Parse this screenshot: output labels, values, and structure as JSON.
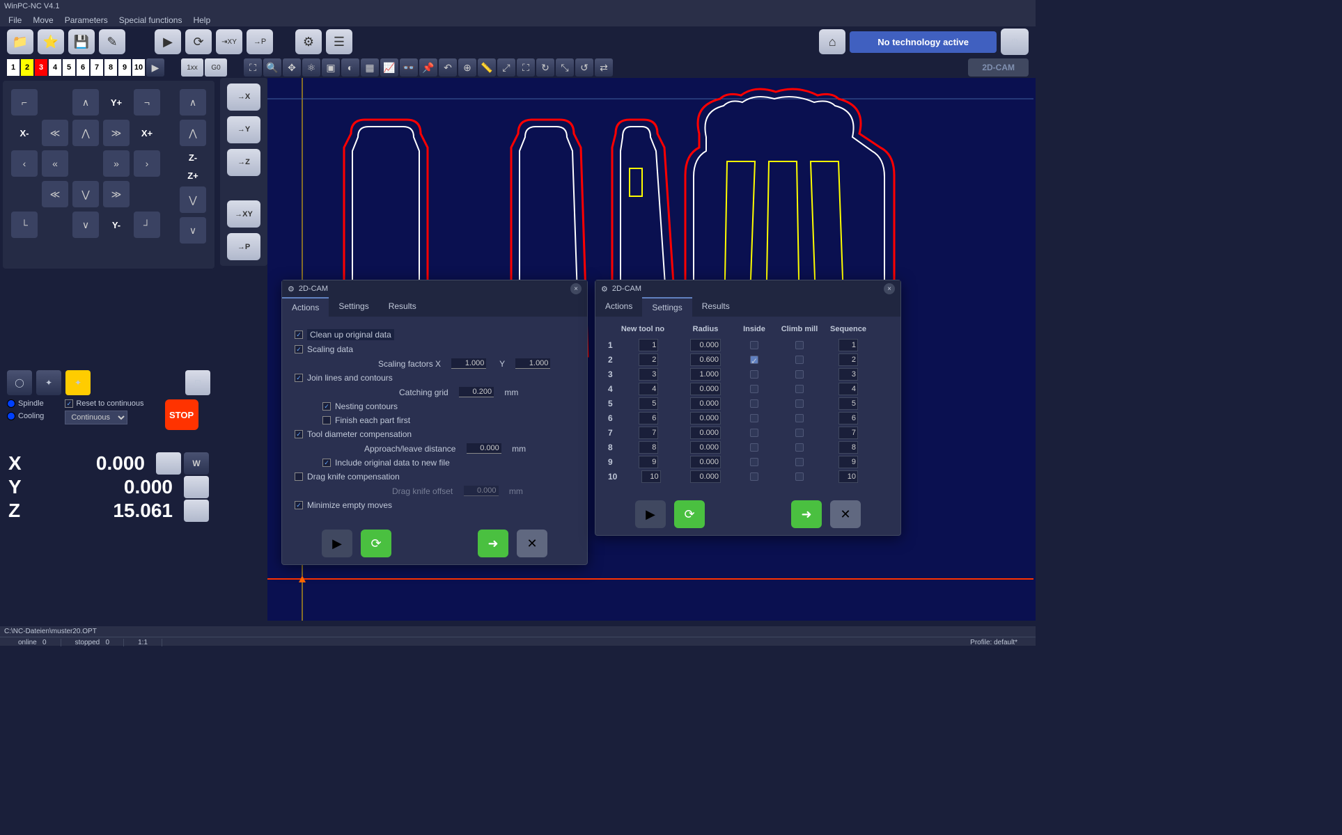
{
  "title": "WinPC-NC V4.1",
  "menu": [
    "File",
    "Move",
    "Parameters",
    "Special functions",
    "Help"
  ],
  "tech_status": "No technology active",
  "toolbar2": {
    "nums": [
      "1",
      "2",
      "3",
      "4",
      "5",
      "6",
      "7",
      "8",
      "9",
      "10"
    ],
    "btn_1xx": "1xx",
    "btn_g0": "G0",
    "cam_label": "2D-CAM"
  },
  "jog": {
    "yplus": "Y+",
    "yminus": "Y-",
    "xplus": "X+",
    "xminus": "X-",
    "zplus": "Z+",
    "zminus": "Z-"
  },
  "mid": {
    "x": "X",
    "y": "Y",
    "z": "Z",
    "xy": "XY",
    "p": "→P"
  },
  "ctrl": {
    "spindle": "Spindle",
    "cooling": "Cooling",
    "reset": "Reset to continuous",
    "mode": "Continuous",
    "stop": "STOP"
  },
  "coords": {
    "X": "0.000",
    "Y": "0.000",
    "Z": "15.061",
    "w": "W"
  },
  "dlg1": {
    "title": "2D-CAM",
    "tabs": [
      "Actions",
      "Settings",
      "Results"
    ],
    "active": "Actions",
    "cleanup": "Clean up original data",
    "scaling": "Scaling data",
    "scaling_x_lbl": "Scaling factors  X",
    "scaling_x": "1.000",
    "scaling_y_lbl": "Y",
    "scaling_y": "1.000",
    "join": "Join lines and contours",
    "grid_lbl": "Catching grid",
    "grid": "0.200",
    "mm": "mm",
    "nesting": "Nesting contours",
    "finish": "Finish each part first",
    "tooldiam": "Tool diameter compensation",
    "approach_lbl": "Approach/leave distance",
    "approach": "0.000",
    "include": "Include original data to new file",
    "drag": "Drag knife compensation",
    "dragoff_lbl": "Drag knife offset",
    "dragoff": "0.000",
    "minimize": "Minimize empty moves"
  },
  "dlg2": {
    "title": "2D-CAM",
    "tabs": [
      "Actions",
      "Settings",
      "Results"
    ],
    "active": "Settings",
    "hdr": [
      "New tool no",
      "Radius",
      "Inside",
      "Climb mill",
      "Sequence"
    ],
    "rows": [
      {
        "n": "1",
        "tool": "1",
        "r": "0.000",
        "inside": false,
        "climb": false,
        "seq": "1"
      },
      {
        "n": "2",
        "tool": "2",
        "r": "0.600",
        "inside": true,
        "climb": false,
        "seq": "2"
      },
      {
        "n": "3",
        "tool": "3",
        "r": "1.000",
        "inside": false,
        "climb": false,
        "seq": "3"
      },
      {
        "n": "4",
        "tool": "4",
        "r": "0.000",
        "inside": false,
        "climb": false,
        "seq": "4"
      },
      {
        "n": "5",
        "tool": "5",
        "r": "0.000",
        "inside": false,
        "climb": false,
        "seq": "5"
      },
      {
        "n": "6",
        "tool": "6",
        "r": "0.000",
        "inside": false,
        "climb": false,
        "seq": "6"
      },
      {
        "n": "7",
        "tool": "7",
        "r": "0.000",
        "inside": false,
        "climb": false,
        "seq": "7"
      },
      {
        "n": "8",
        "tool": "8",
        "r": "0.000",
        "inside": false,
        "climb": false,
        "seq": "8"
      },
      {
        "n": "9",
        "tool": "9",
        "r": "0.000",
        "inside": false,
        "climb": false,
        "seq": "9"
      },
      {
        "n": "10",
        "tool": "10",
        "r": "0.000",
        "inside": false,
        "climb": false,
        "seq": "10"
      }
    ]
  },
  "status": {
    "file": "C:\\NC-Dateien\\muster20.OPT",
    "online": "online",
    "online_v": "0",
    "stopped": "stopped",
    "stopped_v": "0",
    "ratio": "1:1",
    "profile": "Profile: default*"
  }
}
